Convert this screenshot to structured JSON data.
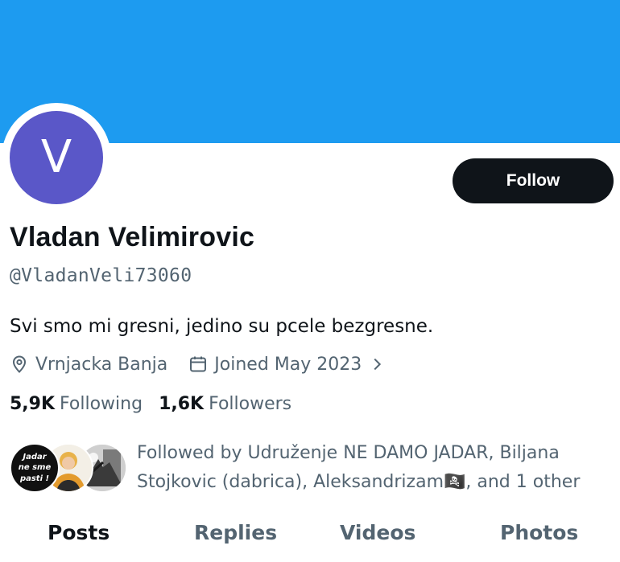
{
  "profile": {
    "avatar_letter": "V",
    "avatar_color": "#5a57c8",
    "banner_color": "#1d9bf0",
    "display_name": "Vladan Velimirovic",
    "handle": "@VladanVeli73060",
    "bio": "Svi smo mi gresni, jedino su pcele bezgresne.",
    "location": "Vrnjacka Banja",
    "joined": "Joined May 2023",
    "follow_label": "Follow"
  },
  "stats": {
    "following_count": "5,9K",
    "following_label": "Following",
    "followers_count": "1,6K",
    "followers_label": "Followers"
  },
  "followed_by": {
    "avatar1_lines": [
      "Jadar",
      "ne sme",
      "pasti !"
    ],
    "text": "Followed by Udruženje NE DAMO JADAR, Biljana Stojkovic (dabrica), Aleksandrizam🏴‍☠️, and 1 other"
  },
  "tabs": [
    {
      "label": "Posts",
      "active": true
    },
    {
      "label": "Replies",
      "active": false
    },
    {
      "label": "Videos",
      "active": false
    },
    {
      "label": "Photos",
      "active": false
    }
  ],
  "icons": {
    "location": "location-pin-icon",
    "calendar": "calendar-icon",
    "chevron": "chevron-right-icon"
  }
}
